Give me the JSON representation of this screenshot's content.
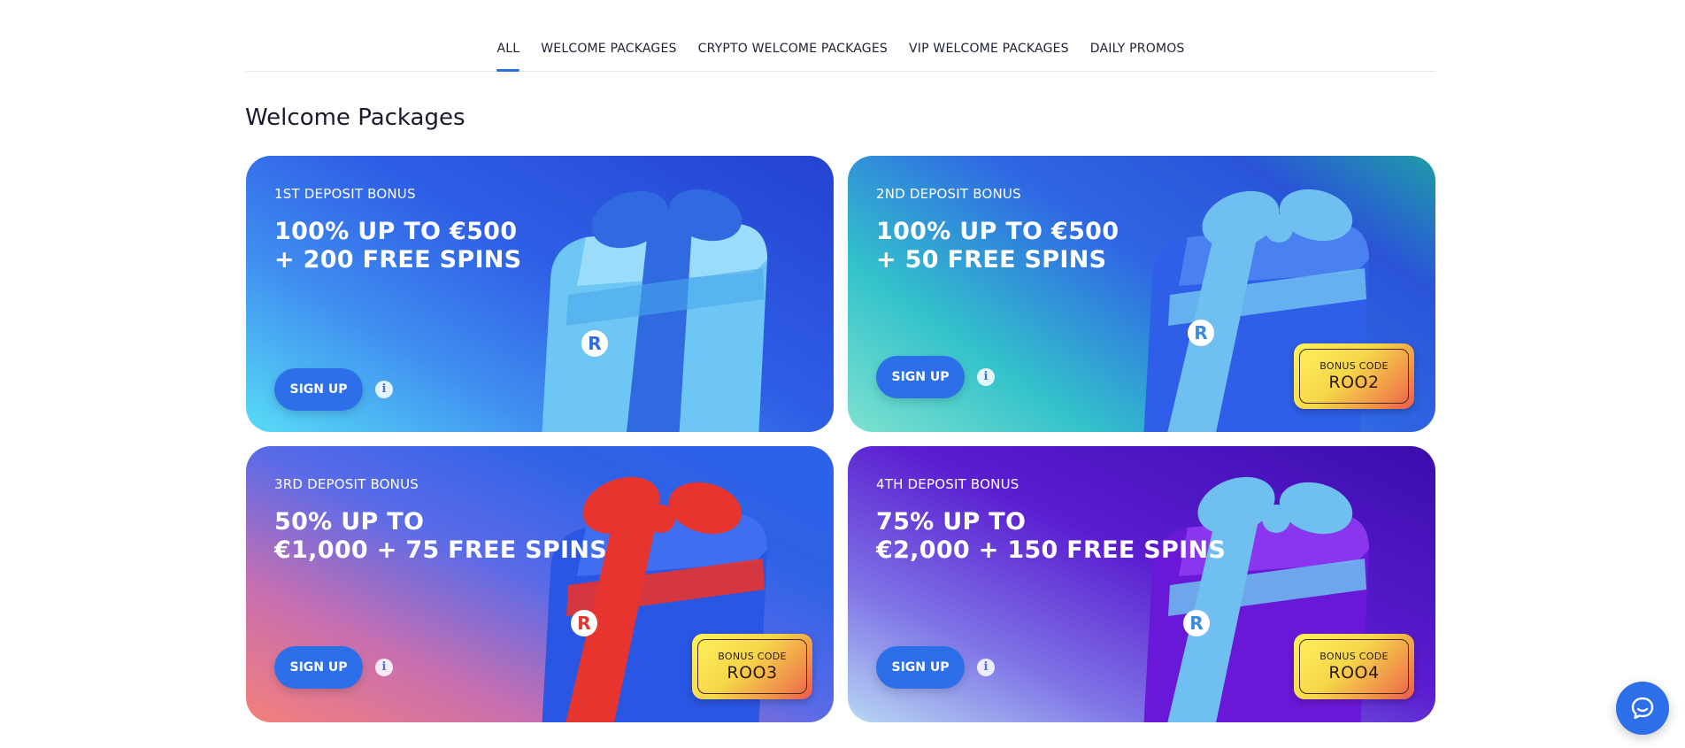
{
  "tabs": [
    {
      "label": "ALL",
      "active": true
    },
    {
      "label": "WELCOME PACKAGES",
      "active": false
    },
    {
      "label": "CRYPTO WELCOME PACKAGES",
      "active": false
    },
    {
      "label": "VIP WELCOME PACKAGES",
      "active": false
    },
    {
      "label": "DAILY PROMOS",
      "active": false
    }
  ],
  "section_title": "Welcome Packages",
  "cards": [
    {
      "label": "1ST DEPOSIT BONUS",
      "headline": [
        "100% UP TO €500",
        "+ 200 FREE SPINS"
      ],
      "button": "SIGN UP",
      "info_icon": "info-icon",
      "ribbon_color": "#2f6ae0"
    },
    {
      "label": "2ND DEPOSIT BONUS",
      "headline": [
        "100% UP TO €500",
        "+ 50 FREE SPINS"
      ],
      "button": "SIGN UP",
      "info_icon": "info-icon",
      "bonus_title": "BONUS CODE",
      "bonus_code": "ROO2",
      "ribbon_color": "#6fc0f0"
    },
    {
      "label": "3RD DEPOSIT BONUS",
      "headline": [
        "50% UP TO",
        "€1,000 + 75 FREE SPINS"
      ],
      "button": "SIGN UP",
      "info_icon": "info-icon",
      "bonus_title": "BONUS CODE",
      "bonus_code": "ROO3",
      "ribbon_color": "#e8342f"
    },
    {
      "label": "4TH DEPOSIT BONUS",
      "headline": [
        "75% UP TO",
        "€2,000 + 150 FREE SPINS"
      ],
      "button": "SIGN UP",
      "info_icon": "info-icon",
      "bonus_title": "BONUS CODE",
      "bonus_code": "ROO4",
      "ribbon_color": "#6fc0f0"
    }
  ],
  "chat_icon": "chat-icon",
  "colors": {
    "accent": "#2d6fe8"
  }
}
